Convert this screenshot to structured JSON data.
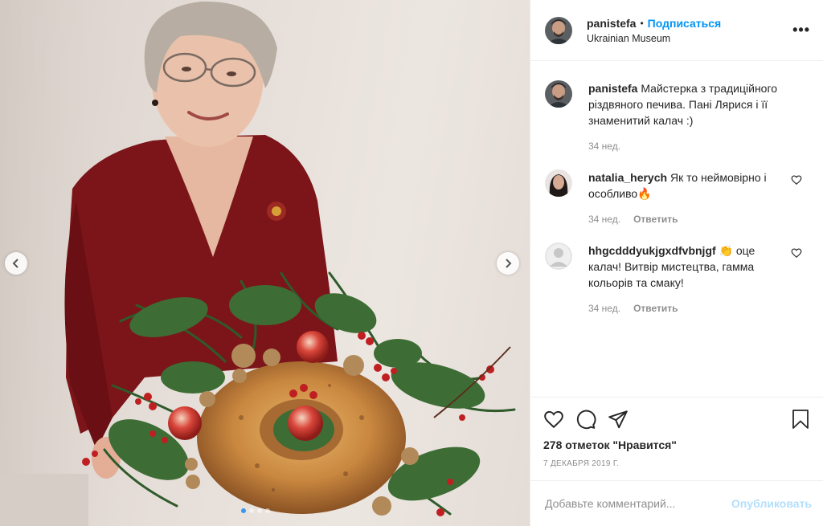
{
  "post": {
    "author": "panistefa",
    "follow_label": "Подписаться",
    "separator": "•",
    "location": "Ukrainian Museum",
    "more_label": "•••"
  },
  "photo": {
    "slide_count": 4,
    "active_slide": 1
  },
  "caption": {
    "username": "panistefa",
    "text": "Майстерка з традиційного різдвяного печива. Пані Лярися і її знаменитий калач :)",
    "time": "34 нед."
  },
  "comments": [
    {
      "username": "natalia_herych",
      "text": "Як то неймовірно і особливо🔥",
      "time": "34 нед.",
      "reply_label": "Ответить"
    },
    {
      "username": "hhgcdddyukjgxdfvbnjgf",
      "text": "👏 оце калач! Витвір мистецтва, гамма кольорів та смаку!",
      "time": "34 нед.",
      "reply_label": "Ответить"
    }
  ],
  "stats": {
    "likes_text": "278 отметок \"Нравится\"",
    "date": "7 ДЕКАБРЯ 2019 Г."
  },
  "add_comment": {
    "placeholder": "Добавьте комментарий...",
    "publish_label": "Опубликовать"
  },
  "colors": {
    "accent": "#0095f6",
    "publish_disabled": "#b2dffc",
    "muted": "#8e8e8e"
  }
}
